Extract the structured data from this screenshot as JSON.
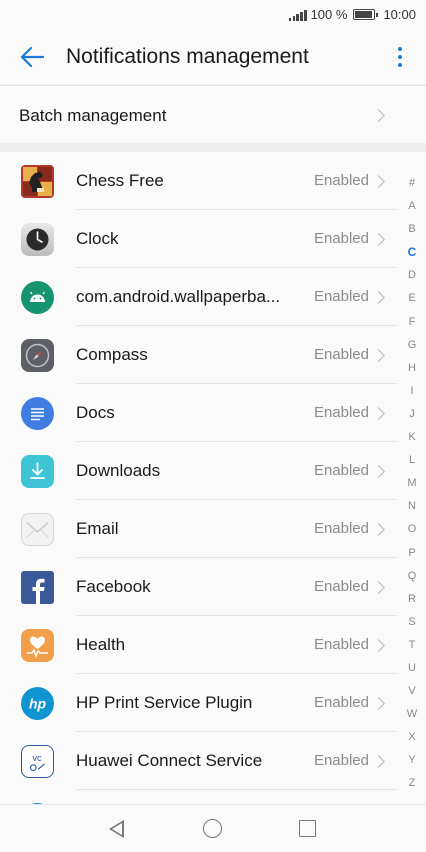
{
  "status_bar": {
    "battery_percent": "100 %",
    "time": "10:00",
    "battery_level": 1.0
  },
  "header": {
    "title": "Notifications management",
    "back_icon": "arrow-left-icon",
    "menu_icon": "more-vertical-icon",
    "accent": "#1a7bd6"
  },
  "batch": {
    "label": "Batch management"
  },
  "apps": [
    {
      "name": "Chess Free",
      "status": "Enabled",
      "icon": "chess-icon"
    },
    {
      "name": "Clock",
      "status": "Enabled",
      "icon": "clock-icon"
    },
    {
      "name": "com.android.wallpaperba...",
      "status": "Enabled",
      "icon": "android-icon"
    },
    {
      "name": "Compass",
      "status": "Enabled",
      "icon": "compass-icon"
    },
    {
      "name": "Docs",
      "status": "Enabled",
      "icon": "docs-icon"
    },
    {
      "name": "Downloads",
      "status": "Enabled",
      "icon": "download-icon"
    },
    {
      "name": "Email",
      "status": "Enabled",
      "icon": "email-icon"
    },
    {
      "name": "Facebook",
      "status": "Enabled",
      "icon": "facebook-icon"
    },
    {
      "name": "Health",
      "status": "Enabled",
      "icon": "health-icon"
    },
    {
      "name": "HP Print Service Plugin",
      "status": "Enabled",
      "icon": "hp-icon"
    },
    {
      "name": "Huawei Connect Service",
      "status": "Enabled",
      "icon": "huawei-connect-icon"
    }
  ],
  "index_letters": [
    "#",
    "A",
    "B",
    "C",
    "D",
    "E",
    "F",
    "G",
    "H",
    "I",
    "J",
    "K",
    "L",
    "M",
    "N",
    "O",
    "P",
    "Q",
    "R",
    "S",
    "T",
    "U",
    "V",
    "W",
    "X",
    "Y",
    "Z"
  ],
  "active_index": "C"
}
